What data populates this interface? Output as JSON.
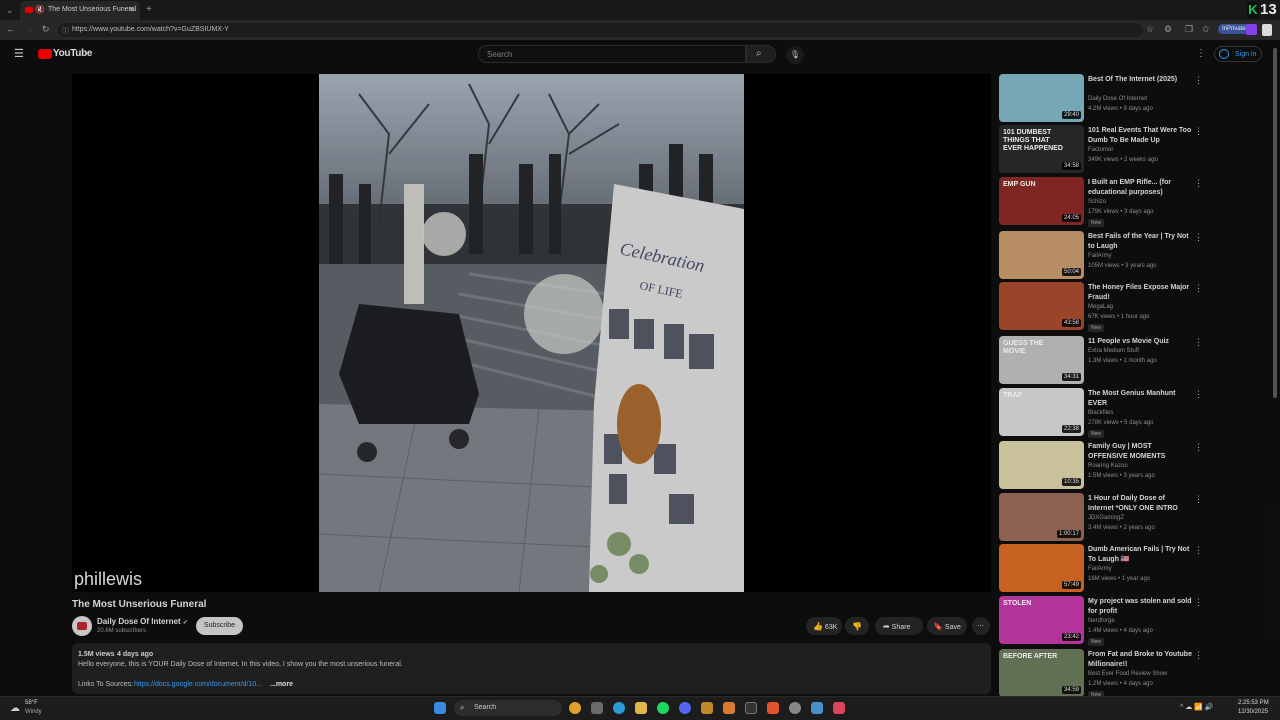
{
  "browser": {
    "tab_title": "The Most Unserious Funeral",
    "url": "https://www.youtube.com/watch?v=GuZBSIUMX-Y",
    "inprivate_label": "InPrivate",
    "badge_number": "13",
    "badge_letter": "K"
  },
  "youtube": {
    "logo_text": "YouTube",
    "search_placeholder": "Search",
    "signin_label": "Sign in"
  },
  "video": {
    "watermark": "phillewis",
    "title": "The Most Unserious Funeral",
    "channel": "Daily Dose Of Internet",
    "subscribers": "20.6M subscribers",
    "subscribe_label": "Subscribe",
    "likes": "63K",
    "share_label": "Share",
    "save_label": "Save",
    "views": "1.5M views",
    "age": "4 days ago",
    "description_line1": "Hello everyone, this is YOUR Daily Dose of Internet. In this video, I show you the most unserious funeral.",
    "links_label": "Links To Sources:",
    "links_url": "https://docs.google.com/document/d/10...",
    "more_label": "...more"
  },
  "recommendations": [
    {
      "title": "Best Of The Internet (2025)",
      "channel": "Daily Dose Of Internet",
      "meta": "4.2M views • 9 days ago",
      "duration": "29:40",
      "new": "",
      "color": "#7fb7c4"
    },
    {
      "title": "101 Real Events That Were Too Dumb To Be Made Up",
      "channel": "Factomer",
      "meta": "349K views • 2 weeks ago",
      "duration": "34:58",
      "new": "",
      "color": "#2a2a2a",
      "thumb_text": "101 DUMBEST THINGS THAT EVER HAPPENED"
    },
    {
      "title": "I Built an EMP Rifle... (for educational purposes)",
      "channel": "Schizo",
      "meta": "179K views • 3 days ago",
      "duration": "24:05",
      "new": "New",
      "color": "#8a2a26",
      "thumb_text": "EMP GUN"
    },
    {
      "title": "Best Fails of the Year | Try Not to Laugh",
      "channel": "FailArmy",
      "meta": "105M views • 3 years ago",
      "duration": "50:04",
      "new": "",
      "color": "#c79a6c"
    },
    {
      "title": "The Honey Files Expose Major Fraud!",
      "channel": "MegaLag",
      "meta": "67K views • 1 hour ago",
      "duration": "43:58",
      "new": "New",
      "color": "#a84a2e"
    },
    {
      "title": "11 People vs Movie Quiz",
      "channel": "Extra Medium Stuff",
      "meta": "1.3M views • 1 month ago",
      "duration": "34:31",
      "new": "",
      "color": "#bfbfbf",
      "thumb_text": "GUESS THE MOVIE"
    },
    {
      "title": "The Most Genius Manhunt EVER",
      "channel": "Blackfiles",
      "meta": "278K views • 5 days ago",
      "duration": "22:38",
      "new": "New",
      "color": "#d8d8d8",
      "thumb_text": "TRAP"
    },
    {
      "title": "Family Guy | MOST OFFENSIVE MOMENTS",
      "channel": "Roaring Kazoo",
      "meta": "1.5M views • 3 years ago",
      "duration": "10:35",
      "new": "",
      "color": "#d9d2a8"
    },
    {
      "title": "1 Hour of Daily Dose of Internet *ONLY ONE INTRO",
      "channel": "JDXGamingZ",
      "meta": "3.4M views • 2 years ago",
      "duration": "1:00:17",
      "new": "",
      "color": "#9a6a5a"
    },
    {
      "title": "Dumb American Fails | Try Not To Laugh 🇺🇸",
      "channel": "FailArmy",
      "meta": "16M views • 1 year ago",
      "duration": "57:49",
      "new": "",
      "color": "#d86a24"
    },
    {
      "title": "My project was stolen and sold for profit",
      "channel": "Nerdforge",
      "meta": "1.4M views • 4 days ago",
      "duration": "23:42",
      "new": "New",
      "color": "#c43aa6",
      "thumb_text": "STOLEN"
    },
    {
      "title": "From Fat and Broke to Youtube Millionaire!!",
      "channel": "Best Ever Food Review Show",
      "meta": "1.2M views • 4 days ago",
      "duration": "34:59",
      "new": "New",
      "color": "#6a7a5a",
      "thumb_text": "BEFORE AFTER"
    }
  ],
  "taskbar": {
    "weather_temp": "58°F",
    "weather_desc": "Windy",
    "search_label": "Search",
    "time": "2:25:53 PM",
    "date": "12/30/2025"
  }
}
